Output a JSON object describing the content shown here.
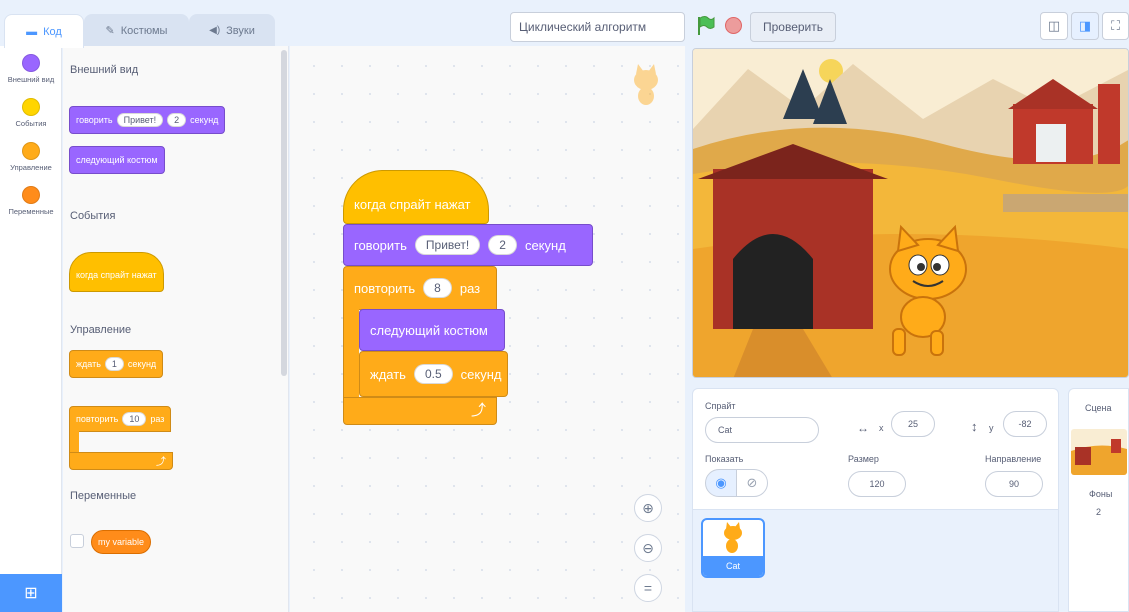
{
  "tabs": [
    {
      "label": "Код",
      "icon": "code-icon"
    },
    {
      "label": "Костюмы",
      "icon": "brush-icon"
    },
    {
      "label": "Звуки",
      "icon": "speaker-icon"
    }
  ],
  "project_title": "Циклический алгоритм",
  "check_button": "Проверить",
  "categories": [
    {
      "label": "Внешний вид",
      "color": "#9966ff"
    },
    {
      "label": "События",
      "color": "#ffd500"
    },
    {
      "label": "Управление",
      "color": "#ffab19"
    },
    {
      "label": "Переменные",
      "color": "#ff8c1a"
    }
  ],
  "palette": {
    "looks_heading": "Внешний вид",
    "say_block": {
      "verb": "говорить",
      "text": "Привет!",
      "secs": "2",
      "unit": "секунд"
    },
    "next_costume": "следующий костюм",
    "events_heading": "События",
    "when_clicked": "когда спрайт нажат",
    "control_heading": "Управление",
    "wait_block": {
      "verb": "ждать",
      "secs": "1",
      "unit": "секунд"
    },
    "repeat_block": {
      "verb": "повторить",
      "times": "10",
      "unit": "раз"
    },
    "variables_heading": "Переменные",
    "variable_name": "my variable"
  },
  "script": {
    "hat": "когда спрайт нажат",
    "say": {
      "verb": "говорить",
      "text": "Привет!",
      "secs": "2",
      "unit": "секунд"
    },
    "repeat": {
      "verb": "повторить",
      "times": "8",
      "unit": "раз"
    },
    "next_costume": "следующий костюм",
    "wait": {
      "verb": "ждать",
      "secs": "0.5",
      "unit": "секунд"
    },
    "loop_arrow": "⤴"
  },
  "sprite_info": {
    "sprite_label": "Спрайт",
    "sprite_name": "Cat",
    "x_icon": "↔",
    "x_label": "x",
    "x_value": "25",
    "y_icon": "↕",
    "y_label": "y",
    "y_value": "-82",
    "show_label": "Показать",
    "size_label": "Размер",
    "size_value": "120",
    "direction_label": "Направление",
    "direction_value": "90"
  },
  "sprite_list": [
    {
      "name": "Cat"
    }
  ],
  "scene": {
    "label": "Сцена",
    "backdrops_label": "Фоны",
    "backdrops_count": "2"
  },
  "colors": {
    "accent": "#4c97ff",
    "looks": "#9966ff",
    "events": "#ffbf00",
    "control": "#ffab19",
    "variables": "#ff8c1a"
  }
}
